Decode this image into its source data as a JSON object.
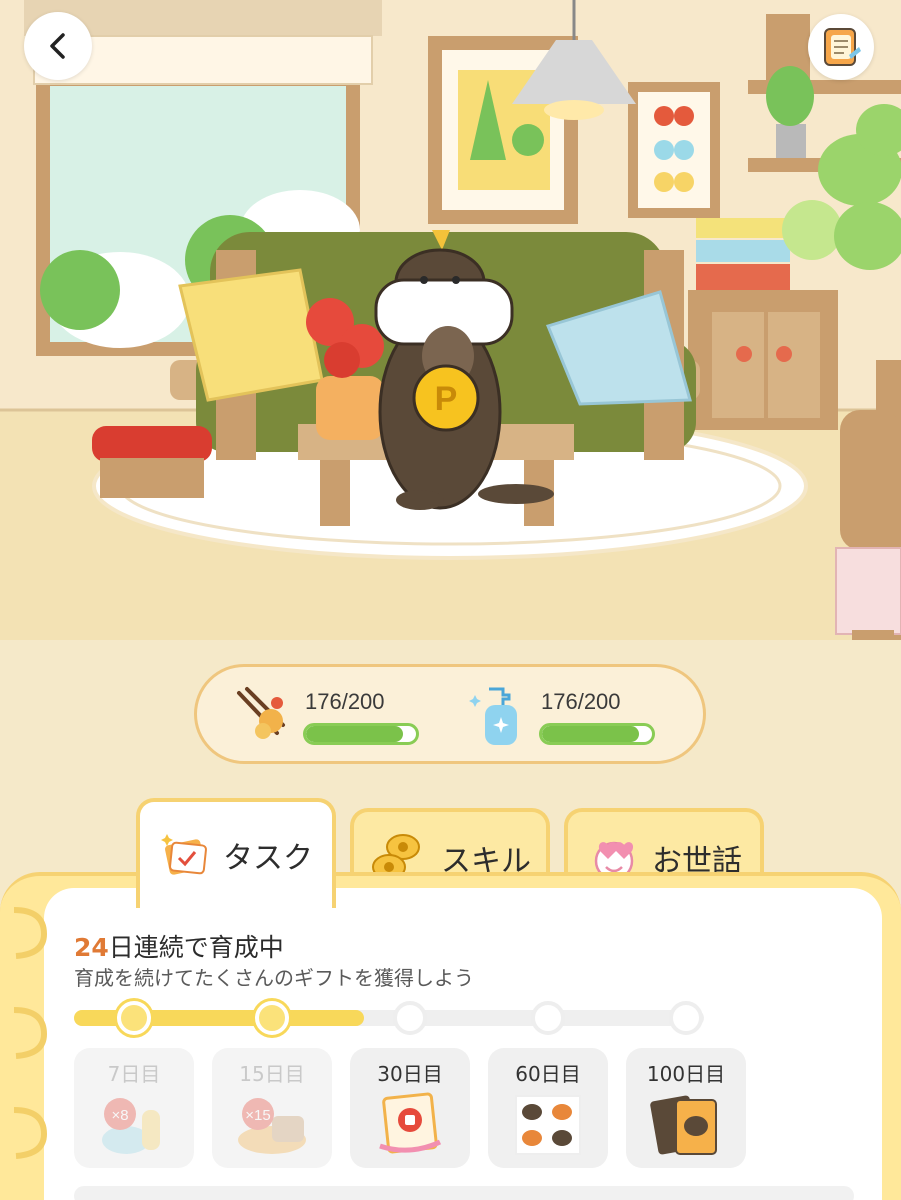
{
  "header": {
    "back_icon": "chevron-left-icon",
    "notebook_icon": "notebook-icon"
  },
  "status": {
    "food": {
      "icon": "fried-food-chopsticks-icon",
      "text": "176/200",
      "current": 176,
      "max": 200
    },
    "clean": {
      "icon": "soap-bottle-icon",
      "text": "176/200",
      "current": 176,
      "max": 200
    }
  },
  "tabs": [
    {
      "label": "タスク",
      "icon": "task-cards-icon",
      "active": true
    },
    {
      "label": "スキル",
      "icon": "coins-icon",
      "active": false
    },
    {
      "label": "お世話",
      "icon": "smiling-face-hearts-icon",
      "active": false
    }
  ],
  "streak": {
    "count": "24",
    "text": "日連続で育成中",
    "subtitle": "育成を続けてたくさんのギフトを獲得しよう"
  },
  "milestones": {
    "progress_fraction": 0.46,
    "nodes_done": 2,
    "rewards": [
      {
        "day": "7日目",
        "state": "past",
        "badge": "×8",
        "icon": "flower-bowl-icon"
      },
      {
        "day": "15日目",
        "state": "past",
        "badge": "×15",
        "icon": "flower-bread-icon"
      },
      {
        "day": "30日目",
        "state": "upcoming",
        "icon": "thumbs-up-scroll-icon"
      },
      {
        "day": "60日目",
        "state": "upcoming",
        "icon": "otter-stickers-icon"
      },
      {
        "day": "100日目",
        "state": "upcoming",
        "icon": "otter-cards-icon"
      }
    ]
  },
  "colors": {
    "accent": "#e07a35",
    "bar_green": "#7bc24a",
    "tab_yellow": "#fde9a3",
    "progress_yellow": "#f8d85a"
  }
}
